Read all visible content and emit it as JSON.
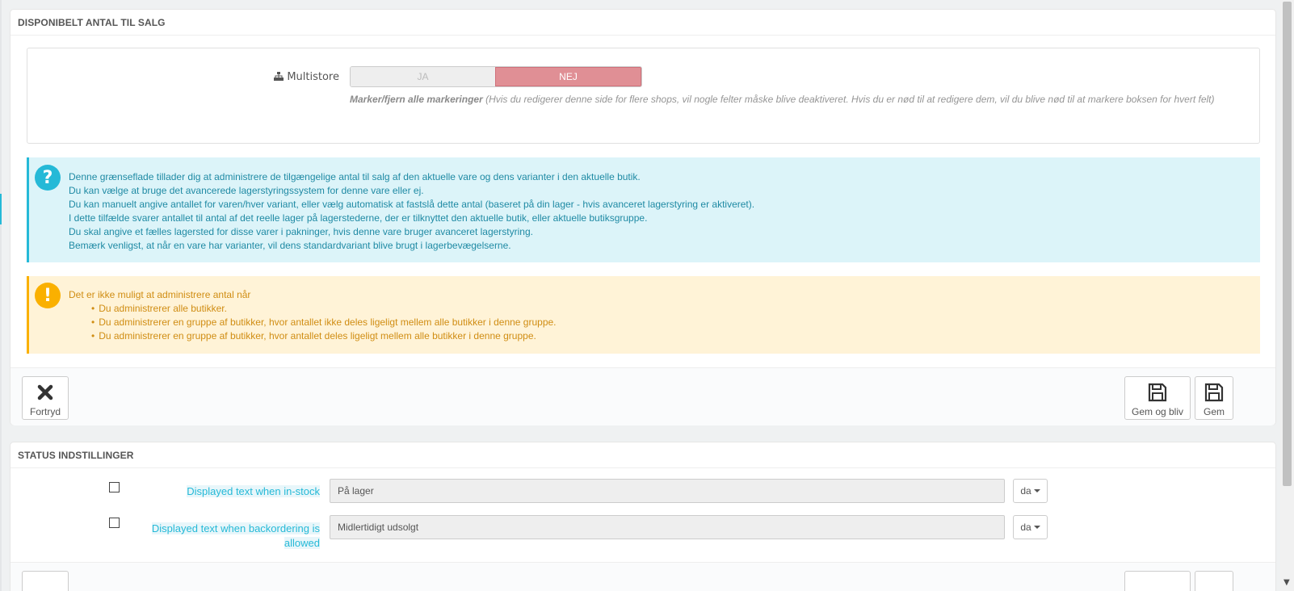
{
  "stock_panel": {
    "title": "DISPONIBELT ANTAL TIL SALG",
    "multistore": {
      "label": "Multistore",
      "yes": "JA",
      "no": "NEJ",
      "selected": "NEJ",
      "help_bold": "Marker/fjern alle markeringer",
      "help_text": "(Hvis du redigerer denne side for flere shops, vil nogle felter måske blive deaktiveret. Hvis du er nød til at redigere dem, vil du blive nød til at markere boksen for hvert felt)"
    },
    "info": {
      "icon": "question-icon",
      "lines": [
        "Denne grænseflade tillader dig at administrere de tilgængelige antal til salg af den aktuelle vare og dens varianter i den aktuelle butik.",
        "Du kan vælge at bruge det avancerede lagerstyringssystem for denne vare eller ej.",
        "Du kan manuelt angive antallet for varen/hver variant, eller vælg automatisk at fastslå dette antal (baseret på din lager - hvis avanceret lagerstyring er aktiveret).",
        "I dette tilfælde svarer antallet til antal af det reelle lager på lagerstederne, der er tilknyttet den aktuelle butik, eller aktuelle butiksgruppe.",
        "Du skal angive et fælles lagersted for disse varer i pakninger, hvis denne vare bruger avanceret lagerstyring.",
        "Bemærk venligst, at når en vare har varianter, vil dens standardvariant blive brugt i lagerbevægelserne."
      ]
    },
    "warning": {
      "icon": "exclamation-icon",
      "intro": "Det er ikke muligt at administrere antal når",
      "items": [
        "Du administrerer alle butikker.",
        "Du administrerer en gruppe af butikker, hvor antallet ikke deles ligeligt mellem alle butikker i denne gruppe.",
        "Du administrerer en gruppe af butikker, hvor antallet deles ligeligt mellem alle butikker i denne gruppe."
      ]
    },
    "footer": {
      "cancel": "Fortryd",
      "save_stay": "Gem og bliv",
      "save": "Gem"
    }
  },
  "status_panel": {
    "title": "STATUS INDSTILLINGER",
    "rows": [
      {
        "label": "Displayed text when in-stock",
        "value": "På lager",
        "lang": "da"
      },
      {
        "label_line1": "Displayed text when backordering is",
        "label_line2": "allowed",
        "value": "Midlertidigt udsolgt",
        "lang": "da"
      }
    ]
  },
  "colors": {
    "accent": "#25b9d7",
    "danger_toggle": "#e08f95",
    "warning": "#fab000",
    "info_bg": "#dcf4f9",
    "warning_bg": "#fff3d7"
  }
}
